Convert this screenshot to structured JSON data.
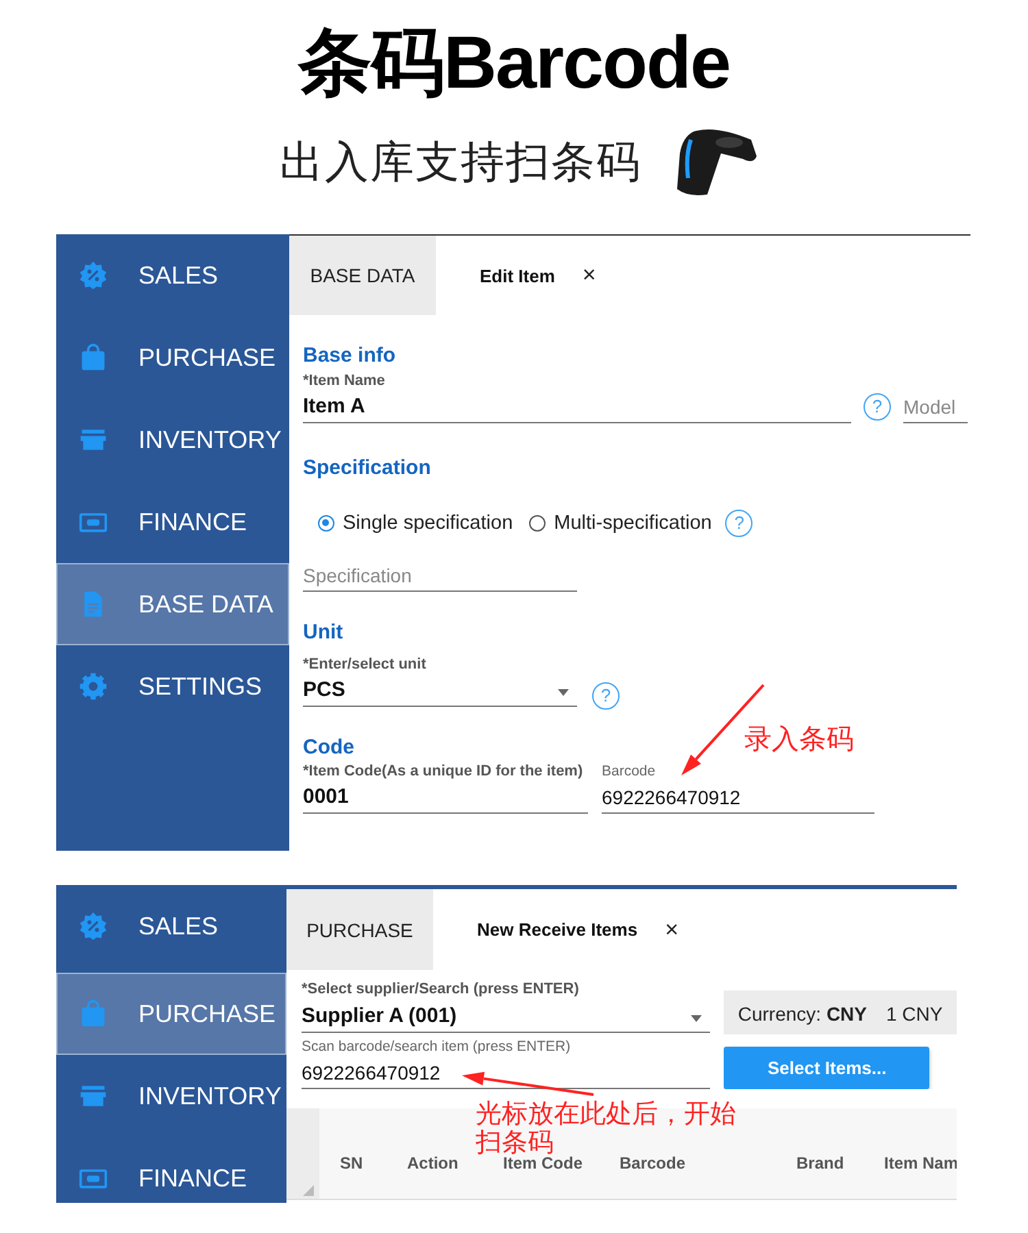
{
  "header": {
    "title": "条码Barcode",
    "subtitle": "出入库支持扫条码"
  },
  "item_screen": {
    "sidebar": {
      "items": [
        {
          "kind": "sales",
          "label": "SALES",
          "selected": false
        },
        {
          "kind": "purchase",
          "label": "PURCHASE",
          "selected": false
        },
        {
          "kind": "inventory",
          "label": "INVENTORY",
          "selected": false
        },
        {
          "kind": "finance",
          "label": "FINANCE",
          "selected": false
        },
        {
          "kind": "basedata",
          "label": "BASE DATA",
          "selected": true
        },
        {
          "kind": "settings",
          "label": "SETTINGS",
          "selected": false
        }
      ]
    },
    "tabs": [
      {
        "label": "BASE DATA",
        "selected": false
      },
      {
        "label": "Edit Item",
        "selected": true,
        "close": "×"
      }
    ],
    "base_info": {
      "heading": "Base info",
      "item_name": {
        "label": "*Item Name",
        "value": "Item A"
      },
      "help": "?",
      "model": {
        "placeholder": "Model"
      }
    },
    "specification": {
      "heading": "Specification",
      "options": [
        {
          "label": "Single specification",
          "selected": true
        },
        {
          "label": "Multi-specification",
          "selected": false
        }
      ],
      "help": "?",
      "field": {
        "placeholder": "Specification"
      }
    },
    "unit": {
      "heading": "Unit",
      "label": "*Enter/select unit",
      "value": "PCS",
      "help": "?"
    },
    "code": {
      "heading": "Code",
      "item_code": {
        "label": "*Item Code(As a unique ID for the item)",
        "value": "0001"
      },
      "barcode": {
        "label": "Barcode",
        "value": "6922266470912"
      }
    }
  },
  "receive_screen": {
    "sidebar": {
      "items": [
        {
          "kind": "sales",
          "label": "SALES",
          "selected": false
        },
        {
          "kind": "purchase",
          "label": "PURCHASE",
          "selected": true
        },
        {
          "kind": "inventory",
          "label": "INVENTORY",
          "selected": false
        },
        {
          "kind": "finance",
          "label": "FINANCE",
          "selected": false
        }
      ]
    },
    "tabs": [
      {
        "label": "PURCHASE",
        "selected": false
      },
      {
        "label": "New Receive Items",
        "selected": true,
        "close": "×"
      }
    ],
    "supplier": {
      "label": "*Select supplier/Search (press ENTER)",
      "value": "Supplier A (001)"
    },
    "currency": {
      "label": "Currency: **CNY**",
      "rate": "1 CNY"
    },
    "scan": {
      "label": "Scan barcode/search item (press ENTER)",
      "value": "6922266470912"
    },
    "select_button": "Select Items...",
    "table": {
      "columns": [
        "SN",
        "Action",
        "Item Code",
        "Barcode",
        "Brand",
        "Item Nam"
      ]
    }
  },
  "annotations": [
    {
      "kind": "barcode",
      "text": "录入条码"
    },
    {
      "kind": "scan",
      "text": "光标放在此处后，开始扫条码"
    }
  ]
}
